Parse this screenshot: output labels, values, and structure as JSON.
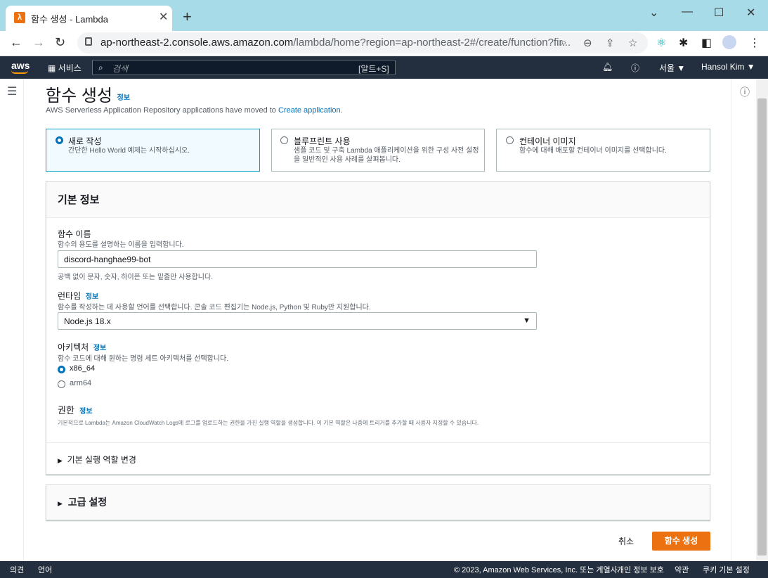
{
  "browser": {
    "tab_title": "함수 생성 - Lambda",
    "url_host": "ap-northeast-2.console.aws.amazon.com",
    "url_path": "/lambda/home?region=ap-northeast-2#/create/function?fir..."
  },
  "aws_header": {
    "logo": "aws",
    "services": "서비스",
    "search_placeholder": "검색",
    "search_shortcut": "[알트+S]",
    "region": "서울 ▼",
    "user": "Hansol Kim ▼"
  },
  "page": {
    "title": "함수 생성",
    "info_link": "정보",
    "notice_text": "AWS Serverless Application Repository applications have moved to",
    "notice_link": "Create application",
    "notice_end": "."
  },
  "options": [
    {
      "title": "새로 작성",
      "desc": "간단한 Hello World 예제는 시작하십시오.",
      "selected": true
    },
    {
      "title": "블루프린트 사용",
      "desc": "샘플 코드 및 구축 Lambda 애플리케이션을 위한 구성 사전 설정을 일반적인 사용 사례를 살펴봅니다.",
      "selected": false
    },
    {
      "title": "컨테이너 이미지",
      "desc": "함수에 대해 배포할 컨테이너 이미지를 선택합니다.",
      "selected": false
    }
  ],
  "basic_info": {
    "header": "기본 정보",
    "function_name_label": "함수 이름",
    "function_name_desc": "함수의 용도를 설명하는 이름을 입력합니다.",
    "function_name_value": "discord-hanghae99-bot",
    "function_name_hint": "공백 없이 문자, 숫자, 하이픈 또는 밑줄만 사용합니다.",
    "runtime_label": "런타임",
    "runtime_info": "정보",
    "runtime_desc": "함수를 작성하는 데 사용할 언어를 선택합니다. 콘솔 코드 편집기는 Node.js, Python 및 Ruby만 지원합니다.",
    "runtime_value": "Node.js 18.x",
    "arch_label": "아키텍처",
    "arch_info": "정보",
    "arch_desc": "함수 코드에 대해 원하는 명령 세트 아키텍처를 선택합니다.",
    "arch_options": [
      "x86_64",
      "arm64"
    ],
    "arch_selected": "x86_64",
    "perm_label": "권한",
    "perm_info": "정보",
    "perm_desc": "기본적으로 Lambda는 Amazon CloudWatch Logs에 로그를 업로드하는 권한을 가진 실행 역할을 생성합니다. 이 기본 역할은 나중에 트리거를 추가할 때 사용자 지정할 수 있습니다.",
    "role_toggle": "기본 실행 역할 변경"
  },
  "advanced": {
    "header": "고급 설정"
  },
  "actions": {
    "cancel": "취소",
    "create": "함수 생성"
  },
  "footer": {
    "feedback": "의견",
    "language": "언어",
    "copyright": "© 2023, Amazon Web Services, Inc. 또는 계열사.",
    "privacy": "개인 정보 보호",
    "terms": "약관",
    "cookies": "쿠키 기본 설정"
  }
}
